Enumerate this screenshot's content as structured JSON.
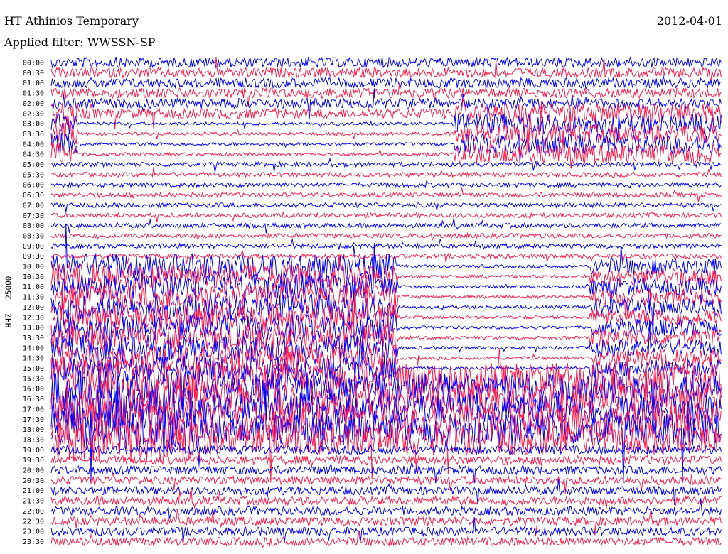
{
  "header": {
    "station": "HT Athinios Temporary",
    "date": "2012-04-01",
    "filter": "Applied filter: WWSSN-SP"
  },
  "chart_data": {
    "type": "line",
    "title": "HT Athinios Temporary",
    "subtitle": "Applied filter: WWSSN-SP",
    "date": "2012-04-01",
    "ylabel": "HHZ - 25000",
    "xlabel": "",
    "row_labels": [
      "00:00",
      "00:30",
      "01:00",
      "01:30",
      "02:00",
      "02:30",
      "03:00",
      "03:30",
      "04:00",
      "04:30",
      "05:00",
      "05:30",
      "06:00",
      "06:30",
      "07:00",
      "07:30",
      "08:00",
      "08:30",
      "09:00",
      "09:30",
      "10:00",
      "10:30",
      "11:00",
      "11:30",
      "12:00",
      "12:30",
      "13:00",
      "13:30",
      "14:00",
      "14:30",
      "15:00",
      "15:30",
      "16:00",
      "16:30",
      "17:00",
      "17:30",
      "18:00",
      "18:30",
      "19:00",
      "19:30",
      "20:00",
      "20:30",
      "21:00",
      "21:30",
      "22:00",
      "22:30",
      "23:00",
      "23:30"
    ],
    "row_colors": [
      "#0000ff",
      "#ff1a4a"
    ],
    "grid": false
  }
}
